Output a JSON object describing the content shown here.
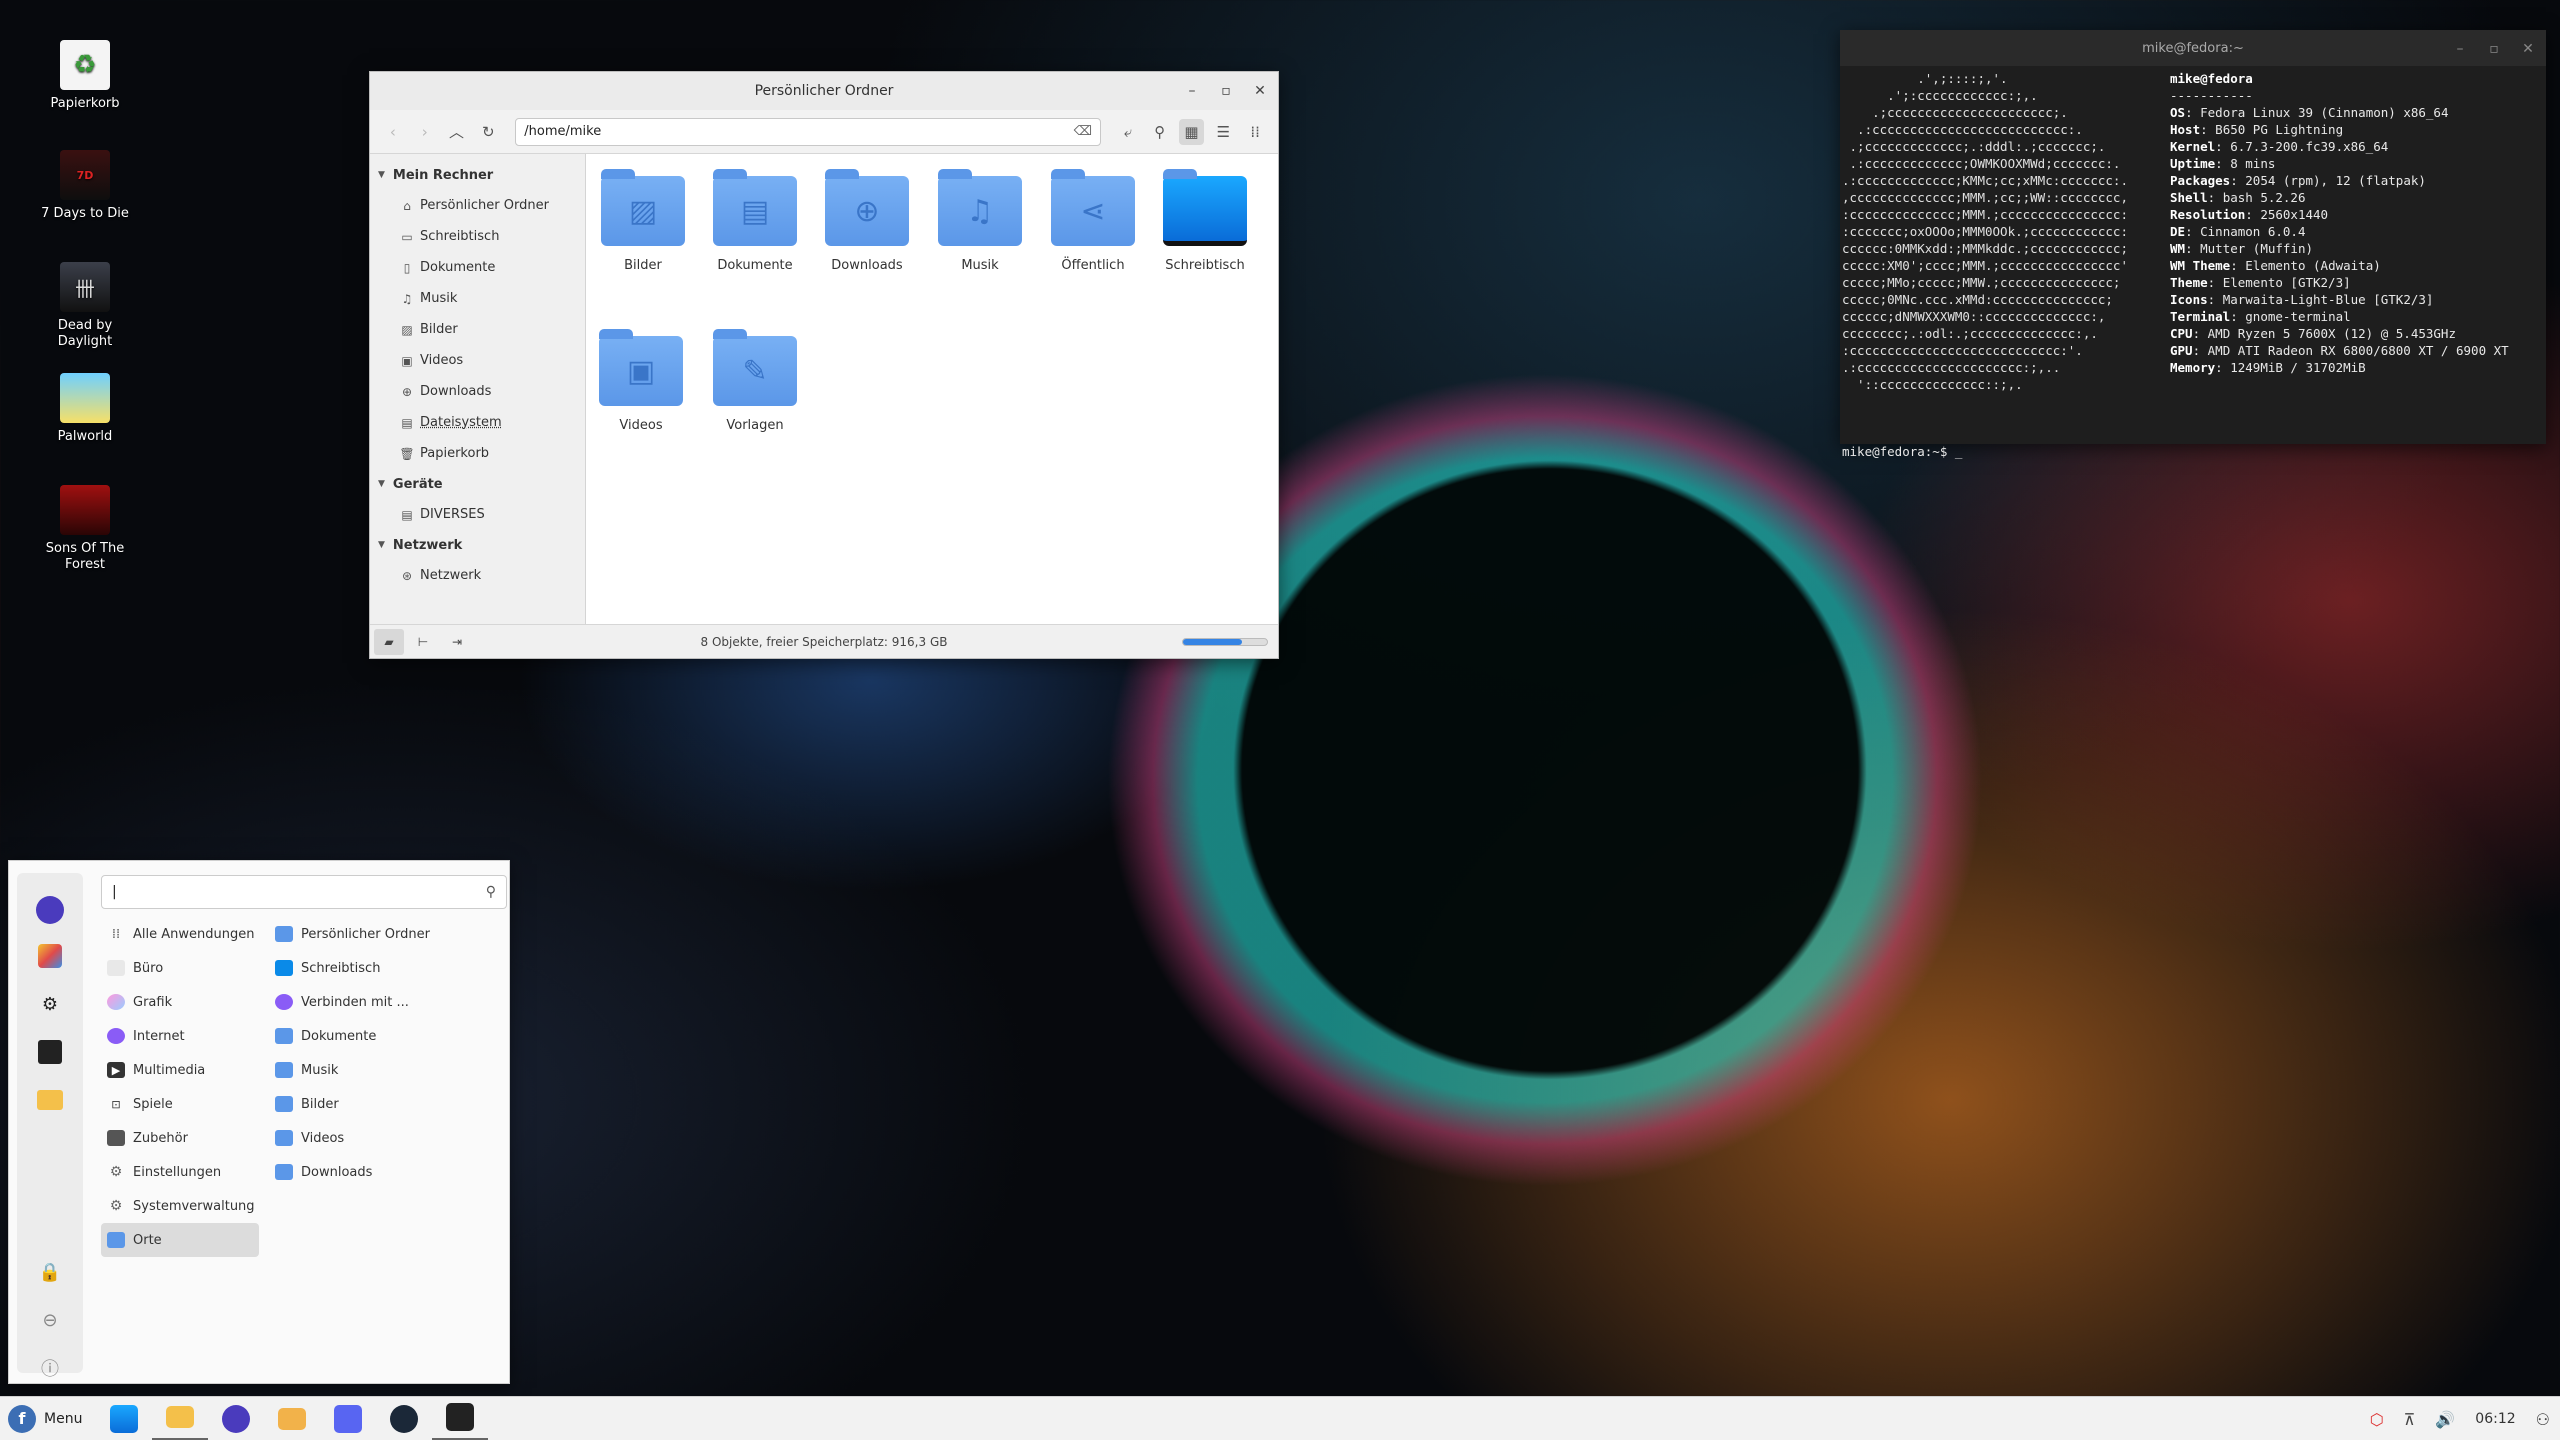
{
  "desktop": {
    "icons": [
      {
        "label": "Papierkorb",
        "name": "trash-icon"
      },
      {
        "label": "7 Days to Die",
        "name": "7-days-to-die-icon"
      },
      {
        "label": "Dead by Daylight",
        "name": "dead-by-daylight-icon"
      },
      {
        "label": "Palworld",
        "name": "palworld-icon"
      },
      {
        "label": "Sons Of The Forest",
        "name": "sons-of-the-forest-icon"
      }
    ]
  },
  "filemanager": {
    "title": "Persönlicher Ordner",
    "path": "/home/mike",
    "sidebar": {
      "sections": [
        {
          "title": "Mein Rechner",
          "items": [
            "Persönlicher Ordner",
            "Schreibtisch",
            "Dokumente",
            "Musik",
            "Bilder",
            "Videos",
            "Downloads",
            "Dateisystem",
            "Papierkorb"
          ]
        },
        {
          "title": "Geräte",
          "items": [
            "DIVERSES"
          ]
        },
        {
          "title": "Netzwerk",
          "items": [
            "Netzwerk"
          ]
        }
      ]
    },
    "folders": [
      "Bilder",
      "Dokumente",
      "Downloads",
      "Musik",
      "Öffentlich",
      "Schreibtisch",
      "Videos",
      "Vorlagen"
    ],
    "status": "8 Objekte, freier Speicherplatz: 916,3 GB",
    "disk_usage_fraction": 0.7
  },
  "terminal": {
    "title": "mike@fedora:~",
    "logo_lines": [
      "          .',;::::;,'.",
      "      .';:cccccccccccc:;,.",
      "    .;cccccccccccccccccccccc;.",
      "  .:cccccccccccccccccccccccccc:.",
      " .;ccccccccccccc;.:dddl:.;ccccccc;.",
      " .:ccccccccccccc;OWMKOOXMWd;ccccccc:.",
      ".:ccccccccccccc;KMMc;cc;xMMc:ccccccc:.",
      ",cccccccccccccc;MMM.;cc;;WW::cccccccc,",
      ":cccccccccccccc;MMM.;cccccccccccccccc:",
      ":ccccccc;oxOOOo;MMM0OOk.;cccccccccccc:",
      "cccccc:0MMKxdd:;MMMkddc.;cccccccccccc;",
      "ccccc:XM0';cccc;MMM.;cccccccccccccccc'",
      "ccccc;MMo;ccccc;MMW.;ccccccccccccccc;",
      "ccccc;0MNc.ccc.xMMd:ccccccccccccccc;",
      "cccccc;dNMWXXXWM0::cccccccccccccc:,",
      "cccccccc;.:odl:.;cccccccccccccc:,.",
      ":cccccccccccccccccccccccccccc:'.",
      ".:cccccccccccccccccccccc:;,..",
      "  '::cccccccccccccc::;,."
    ],
    "user_host": "mike@fedora",
    "separator": "-----------",
    "info": [
      {
        "key": "OS",
        "value": "Fedora Linux 39 (Cinnamon) x86_64"
      },
      {
        "key": "Host",
        "value": "B650 PG Lightning"
      },
      {
        "key": "Kernel",
        "value": "6.7.3-200.fc39.x86_64"
      },
      {
        "key": "Uptime",
        "value": "8 mins"
      },
      {
        "key": "Packages",
        "value": "2054 (rpm), 12 (flatpak)"
      },
      {
        "key": "Shell",
        "value": "bash 5.2.26"
      },
      {
        "key": "Resolution",
        "value": "2560x1440"
      },
      {
        "key": "DE",
        "value": "Cinnamon 6.0.4"
      },
      {
        "key": "WM",
        "value": "Mutter (Muffin)"
      },
      {
        "key": "WM Theme",
        "value": "Elemento (Adwaita)"
      },
      {
        "key": "Theme",
        "value": "Elemento [GTK2/3]"
      },
      {
        "key": "Icons",
        "value": "Marwaita-Light-Blue [GTK2/3]"
      },
      {
        "key": "Terminal",
        "value": "gnome-terminal"
      },
      {
        "key": "CPU",
        "value": "AMD Ryzen 5 7600X (12) @ 5.453GHz"
      },
      {
        "key": "GPU",
        "value": "AMD ATI Radeon RX 6800/6800 XT / 6900 XT"
      },
      {
        "key": "Memory",
        "value": "1249MiB / 31702MiB"
      }
    ],
    "prompt": "mike@fedora:~$ _"
  },
  "startmenu": {
    "search_value": "|",
    "categories": [
      "Alle Anwendungen",
      "Büro",
      "Grafik",
      "Internet",
      "Multimedia",
      "Spiele",
      "Zubehör",
      "Einstellungen",
      "Systemverwaltung",
      "Orte"
    ],
    "selected_category": "Orte",
    "places": [
      "Persönlicher Ordner",
      "Schreibtisch",
      "Verbinden mit ...",
      "Dokumente",
      "Musik",
      "Bilder",
      "Videos",
      "Downloads"
    ]
  },
  "taskbar": {
    "menu_label": "Menu",
    "clock": "06:12"
  },
  "colors": {
    "folder_blue": "#5b97e8",
    "accent": "#3584e4",
    "terminal_bg": "#1e1e1e"
  }
}
